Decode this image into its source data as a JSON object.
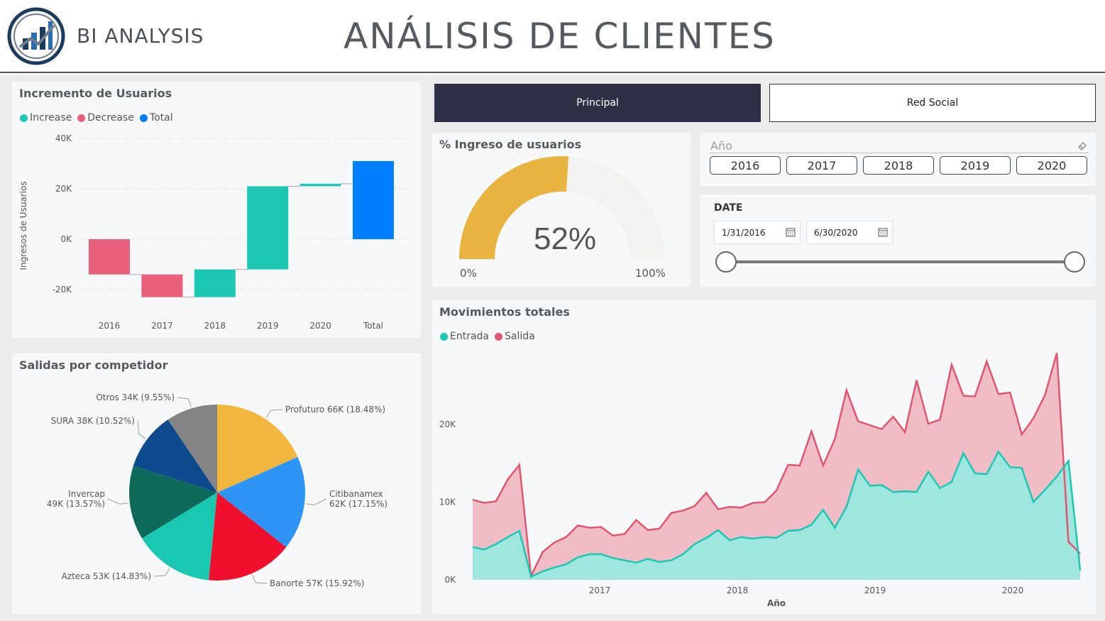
{
  "header": {
    "brand": "BI ANALYSIS",
    "title": "ANÁLISIS DE CLIENTES"
  },
  "nav": {
    "principal": "Principal",
    "red_social": "Red Social"
  },
  "colors": {
    "increase": "#1cc8b4",
    "decrease": "#e8607a",
    "total": "#0080ff",
    "gauge_fill": "#e9b33f",
    "gauge_empty": "#f2f2f0",
    "entrada": "#1cc8b4",
    "salida": "#e0566f",
    "nav_active": "#2e3145"
  },
  "waterfall": {
    "title": "Incremento de Usuarios",
    "legend": [
      "Increase",
      "Decrease",
      "Total"
    ],
    "ylabel": "Ingresos de Usuarios",
    "yticks": [
      "40K",
      "20K",
      "0K",
      "-20K"
    ]
  },
  "gauge": {
    "title": "% Ingreso de usuarios",
    "value_label": "52%",
    "min_label": "0%",
    "max_label": "100%"
  },
  "year_slicer": {
    "title": "Año",
    "years": [
      "2016",
      "2017",
      "2018",
      "2019",
      "2020"
    ]
  },
  "date_slicer": {
    "title": "DATE",
    "start": "1/31/2016",
    "end": "6/30/2020"
  },
  "pie": {
    "title": "Salidas por competidor"
  },
  "area": {
    "title": "Movimientos totales",
    "legend": [
      "Entrada",
      "Salida"
    ],
    "xlabel": "Año",
    "yticks": [
      "20K",
      "10K",
      "0K"
    ],
    "xticks": [
      "2017",
      "2018",
      "2019",
      "2020"
    ]
  },
  "chart_data": [
    {
      "type": "bar",
      "subtype": "waterfall",
      "title": "Incremento de Usuarios",
      "categories": [
        "2016",
        "2017",
        "2018",
        "2019",
        "2020",
        "Total"
      ],
      "values": [
        -14000,
        -9000,
        11000,
        33000,
        1000,
        31000
      ],
      "kind": [
        "decrease",
        "decrease",
        "increase",
        "increase",
        "increase",
        "total"
      ],
      "ylabel": "Ingresos de Usuarios",
      "ylim": [
        -25000,
        40000
      ],
      "legend": [
        "Increase",
        "Decrease",
        "Total"
      ]
    },
    {
      "type": "pie",
      "title": "Salidas por competidor",
      "slices": [
        {
          "name": "Profuturo",
          "value": 66,
          "label": "Profuturo 66K (18.48%)",
          "color": "#f2b53e"
        },
        {
          "name": "Citibanamex",
          "value": 62,
          "label": "Citibanamex 62K (17.15%)",
          "color": "#2e94f5"
        },
        {
          "name": "Banorte",
          "value": 57,
          "label": "Banorte 57K (15.92%)",
          "color": "#f0102e"
        },
        {
          "name": "Azteca",
          "value": 53,
          "label": "Azteca 53K (14.83%)",
          "color": "#18c8b0"
        },
        {
          "name": "Invercap",
          "value": 49,
          "label": "Invercap 49K (13.57%)",
          "color": "#0e6a5a"
        },
        {
          "name": "SURA",
          "value": 38,
          "label": "SURA 38K (10.52%)",
          "color": "#104a8e"
        },
        {
          "name": "Otros",
          "value": 34,
          "label": "Otros 34K (9.55%)",
          "color": "#848484"
        }
      ]
    },
    {
      "type": "area",
      "title": "Movimientos totales",
      "xlabel": "Año",
      "x_start": "2016-02",
      "x_end": "2020-06",
      "ylim": [
        0,
        28000
      ],
      "series": [
        {
          "name": "Entrada",
          "values": [
            4200,
            3900,
            4600,
            5500,
            6300,
            400,
            1100,
            1600,
            2000,
            2900,
            3300,
            3300,
            2800,
            2500,
            2200,
            2700,
            2300,
            2500,
            3300,
            4600,
            5400,
            6400,
            5100,
            5500,
            5300,
            5500,
            5400,
            6300,
            6400,
            7100,
            9000,
            6700,
            9400,
            14200,
            12100,
            12200,
            11300,
            11400,
            11300,
            13900,
            11800,
            12600,
            16300,
            13700,
            13600,
            16500,
            14500,
            14400,
            10000,
            11600,
            13300,
            15300,
            1200,
            200
          ]
        },
        {
          "name": "Salida",
          "values": [
            10300,
            9900,
            10100,
            12900,
            14800,
            500,
            3600,
            4800,
            5500,
            7000,
            6700,
            6800,
            5700,
            5900,
            7700,
            6400,
            6600,
            8600,
            8900,
            9500,
            11200,
            9100,
            9400,
            9300,
            9900,
            10000,
            11500,
            14800,
            14700,
            19100,
            14700,
            18100,
            24400,
            20400,
            19900,
            19400,
            21000,
            19000,
            25700,
            20100,
            20600,
            27700,
            23700,
            23600,
            28100,
            23900,
            24100,
            18700,
            20800,
            23800,
            29200,
            4900,
            3400
          ]
        }
      ]
    }
  ]
}
